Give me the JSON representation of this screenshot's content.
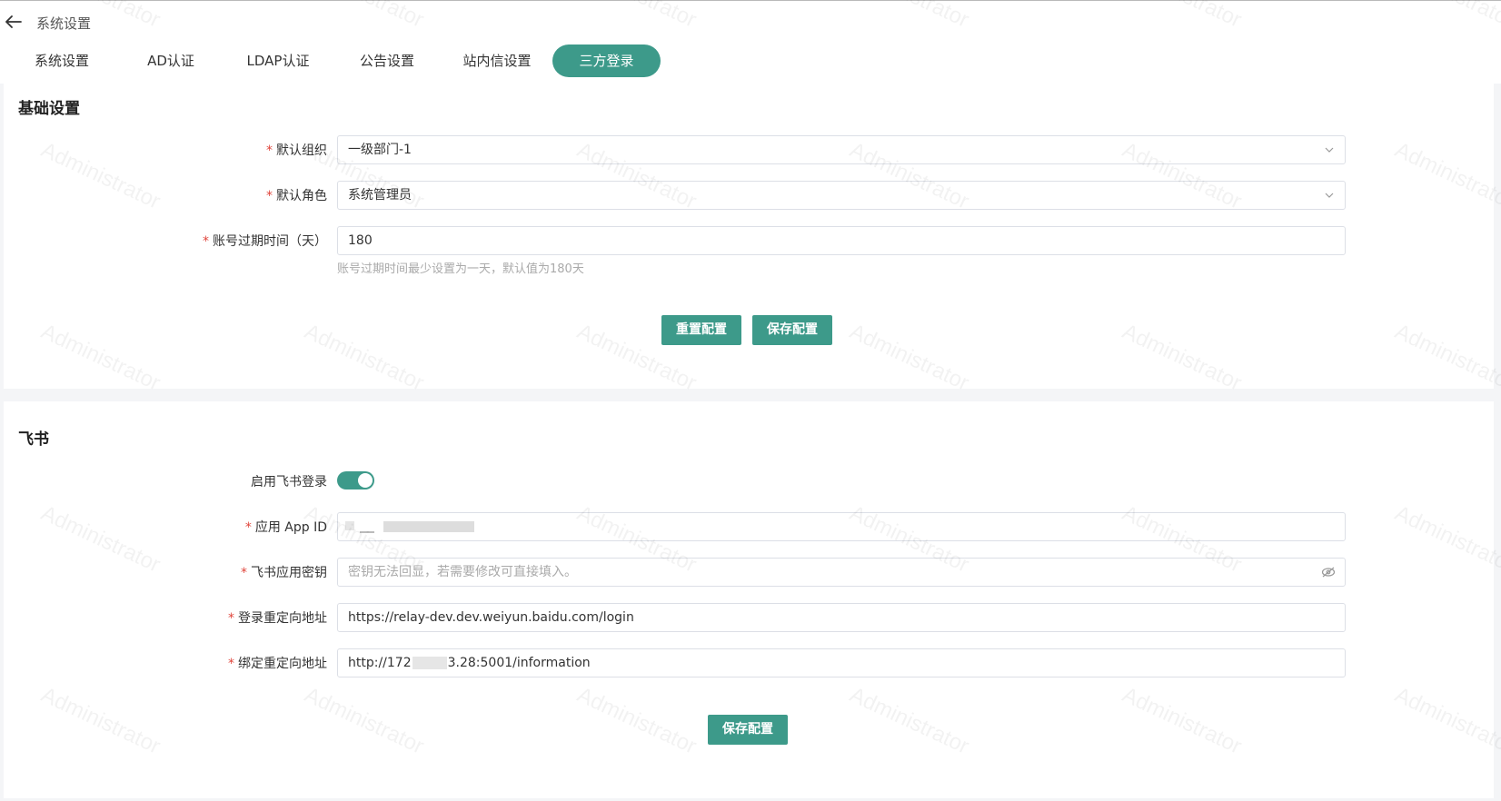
{
  "header": {
    "title": "系统设置",
    "back_icon": "arrow-left-icon"
  },
  "tabs": [
    {
      "label": "系统设置",
      "active": false
    },
    {
      "label": "AD认证",
      "active": false
    },
    {
      "label": "LDAP认证",
      "active": false
    },
    {
      "label": "公告设置",
      "active": false
    },
    {
      "label": "站内信设置",
      "active": false
    },
    {
      "label": "三方登录",
      "active": true
    }
  ],
  "basic": {
    "title": "基础设置",
    "default_org": {
      "label": "默认组织",
      "value": "一级部门-1"
    },
    "default_role": {
      "label": "默认角色",
      "value": "系统管理员"
    },
    "expiry": {
      "label": "账号过期时间（天）",
      "value": "180",
      "hint": "账号过期时间最少设置为一天，默认值为180天"
    },
    "reset_label": "重置配置",
    "save_label": "保存配置"
  },
  "feishu": {
    "title": "飞书",
    "enable": {
      "label": "启用飞书登录",
      "on": true
    },
    "app_id": {
      "label": "应用 App ID",
      "value": ""
    },
    "secret": {
      "label": "飞书应用密钥",
      "placeholder": "密钥无法回显，若需要修改可直接填入。"
    },
    "login_redirect": {
      "label": "登录重定向地址",
      "value": "https://relay-dev.dev.weiyun.baidu.com/login"
    },
    "bind_redirect": {
      "label": "绑定重定向地址",
      "value_prefix": "http://172",
      "value_suffix": "3.28:5001/information"
    },
    "save_label": "保存配置"
  },
  "watermark": "Administrator",
  "colors": {
    "accent": "#3d9a8a",
    "required": "#e0453b"
  }
}
